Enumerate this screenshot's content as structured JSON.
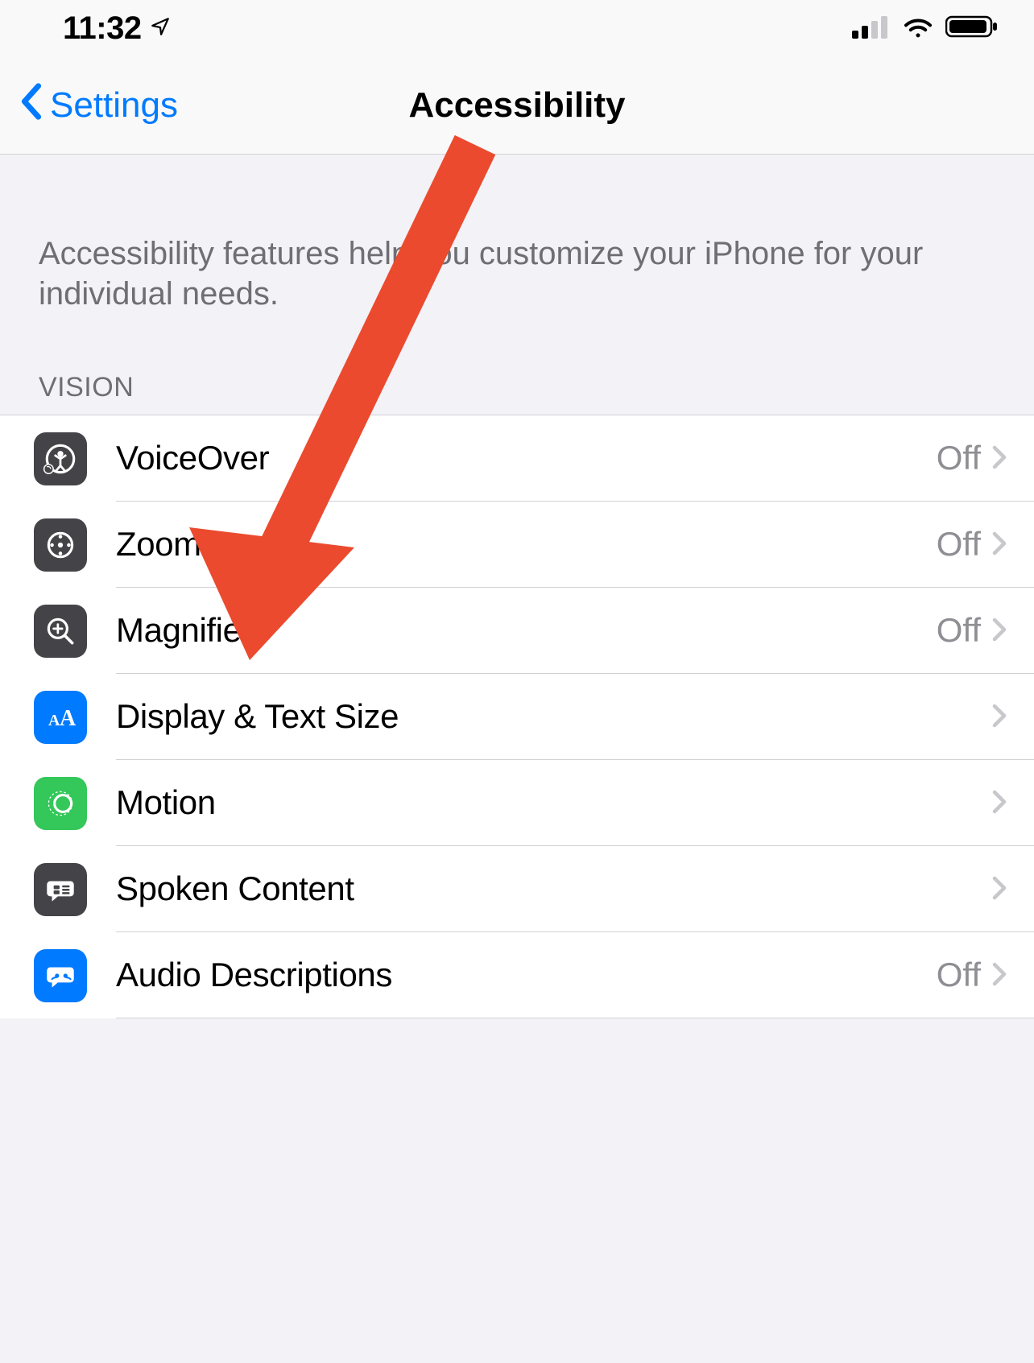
{
  "status": {
    "time": "11:32"
  },
  "nav": {
    "back_label": "Settings",
    "title": "Accessibility"
  },
  "intro": "Accessibility features help you customize your iPhone for your individual needs.",
  "section_header": "VISION",
  "rows": [
    {
      "label": "VoiceOver",
      "value": "Off",
      "icon": "voiceover-icon",
      "icon_bg": "bg-dark"
    },
    {
      "label": "Zoom",
      "value": "Off",
      "icon": "zoom-icon",
      "icon_bg": "bg-dark"
    },
    {
      "label": "Magnifier",
      "value": "Off",
      "icon": "magnifier-icon",
      "icon_bg": "bg-dark"
    },
    {
      "label": "Display & Text Size",
      "value": "",
      "icon": "textsize-icon",
      "icon_bg": "bg-blue"
    },
    {
      "label": "Motion",
      "value": "",
      "icon": "motion-icon",
      "icon_bg": "bg-green"
    },
    {
      "label": "Spoken Content",
      "value": "",
      "icon": "spoken-icon",
      "icon_bg": "bg-dark"
    },
    {
      "label": "Audio Descriptions",
      "value": "Off",
      "icon": "audiodesc-icon",
      "icon_bg": "bg-blue"
    }
  ],
  "annotation": {
    "color": "#eb4a2e"
  }
}
